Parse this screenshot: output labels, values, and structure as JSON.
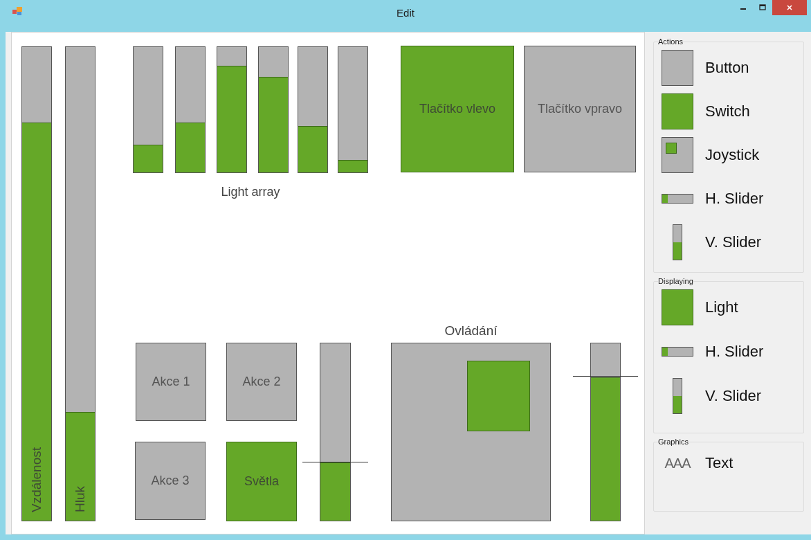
{
  "window": {
    "title": "Edit"
  },
  "canvas": {
    "widgets": [
      {
        "kind": "bar",
        "label": "Vzdálenost",
        "level": 0.84
      },
      {
        "kind": "bar",
        "label": "Hluk",
        "level": 0.23
      },
      {
        "kind": "lightarray",
        "label": "Light array",
        "lights": [
          {
            "level": 0.22
          },
          {
            "level": 0.4
          },
          {
            "level": 0.85
          },
          {
            "level": 0.76
          },
          {
            "level": 0.37
          },
          {
            "level": 0.1
          }
        ]
      },
      {
        "kind": "button",
        "label": "Tlačítko vlevo",
        "on": true
      },
      {
        "kind": "button",
        "label": "Tlačítko vpravo",
        "on": false
      },
      {
        "kind": "button",
        "label": "Akce 1",
        "on": false
      },
      {
        "kind": "button",
        "label": "Akce 2",
        "on": false
      },
      {
        "kind": "button",
        "label": "Akce 3",
        "on": false
      },
      {
        "kind": "button",
        "label": "Světla",
        "on": true
      },
      {
        "kind": "slider",
        "level": 0.33
      },
      {
        "kind": "joystick",
        "label": "Ovládání"
      },
      {
        "kind": "slider",
        "level": 0.81
      }
    ]
  },
  "toolbox": {
    "groups": [
      {
        "title": "Actions",
        "items": [
          {
            "kind": "button",
            "label": "Button"
          },
          {
            "kind": "switch",
            "label": "Switch"
          },
          {
            "kind": "joystick",
            "label": "Joystick"
          },
          {
            "kind": "hslider",
            "label": "H. Slider"
          },
          {
            "kind": "vslider",
            "label": "V. Slider"
          }
        ]
      },
      {
        "title": "Displaying",
        "items": [
          {
            "kind": "light",
            "label": "Light"
          },
          {
            "kind": "hslider",
            "label": "H. Slider"
          },
          {
            "kind": "vslider",
            "label": "V. Slider"
          }
        ]
      },
      {
        "title": "Graphics",
        "items": [
          {
            "kind": "text",
            "sample": "AAA",
            "label": "Text"
          }
        ]
      }
    ]
  }
}
